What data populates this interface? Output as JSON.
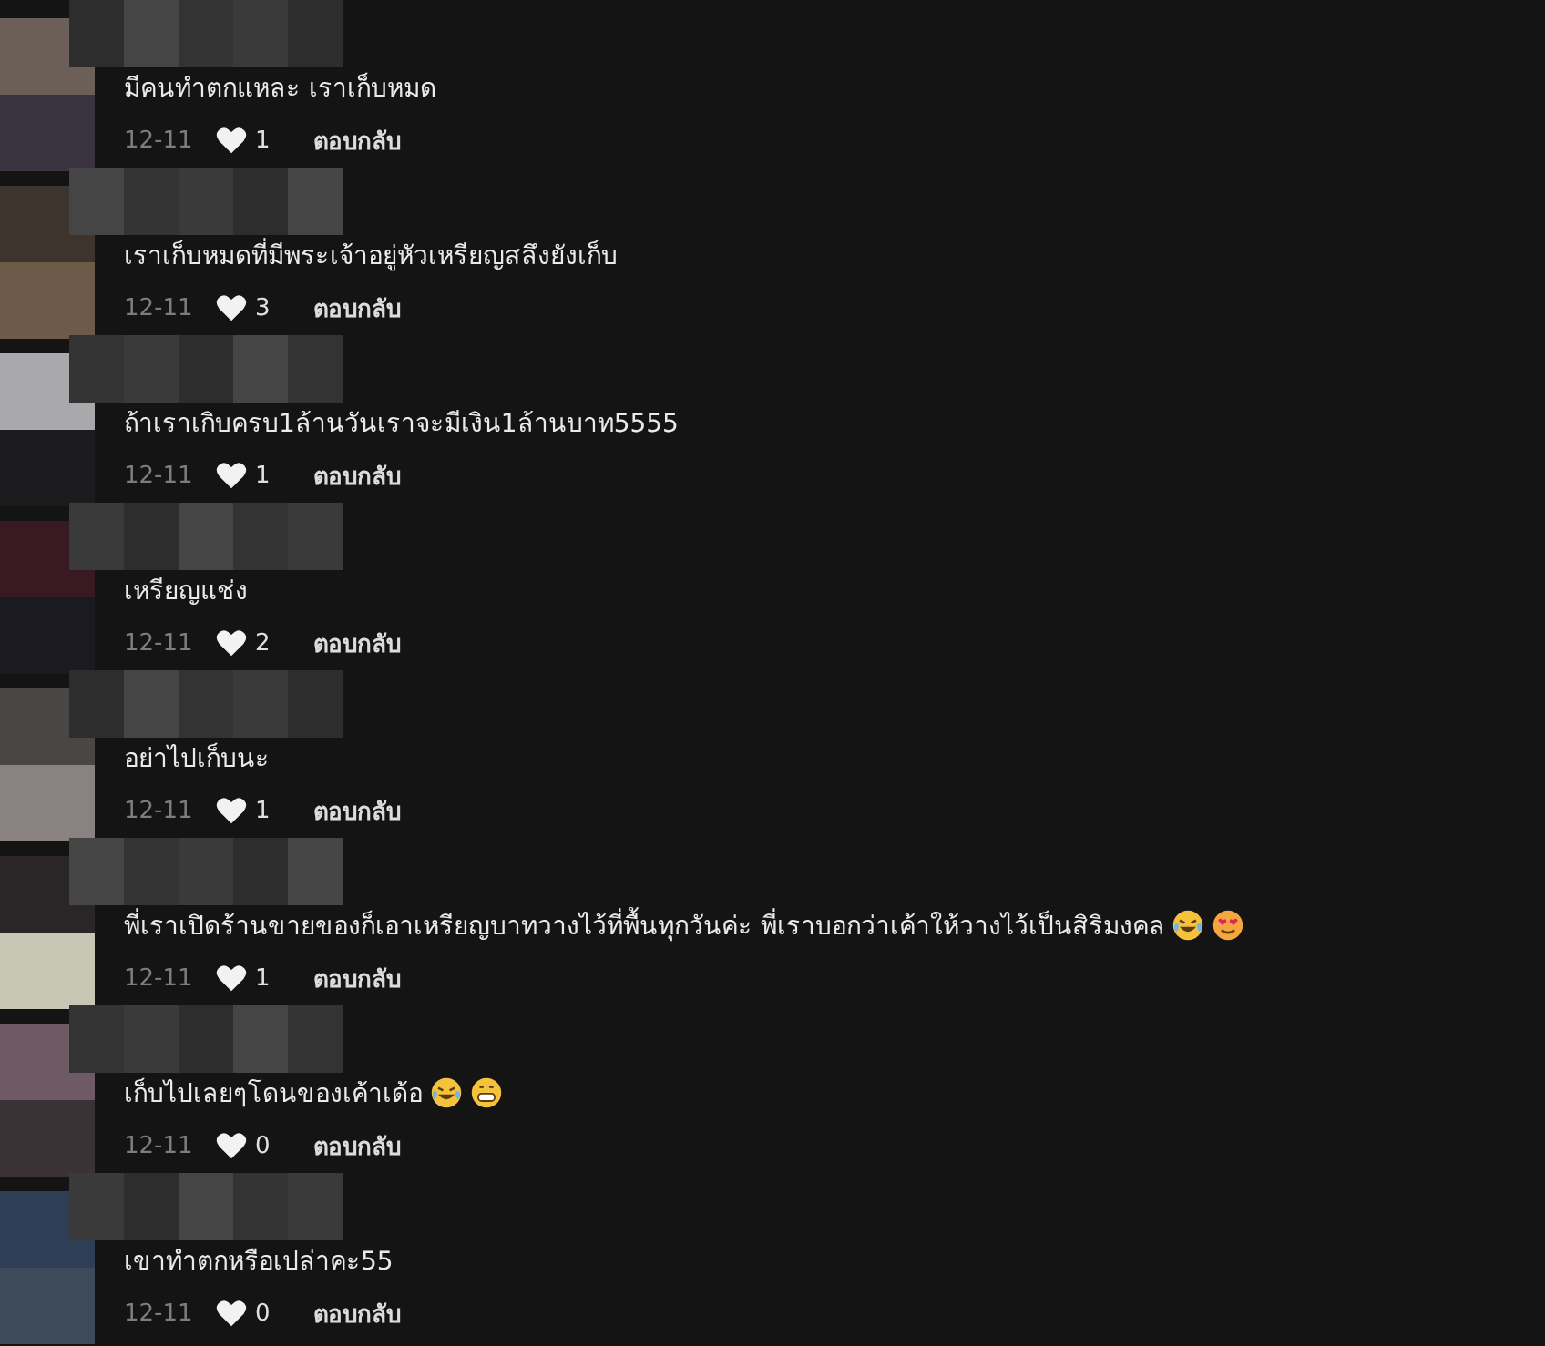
{
  "comments": [
    {
      "text": "มีคนทำตกแหละ เราเก็บหมด",
      "date": "12-11",
      "likes": "1",
      "reply": "ตอบกลับ"
    },
    {
      "text": "เราเก็บหมดที่มีพระเจ้าอยู่หัวเหรียญสลึงยังเก็บ",
      "date": "12-11",
      "likes": "3",
      "reply": "ตอบกลับ"
    },
    {
      "text": "ถ้าเราเกิบครบ1ล้านวันเราจะมีเงิน1ล้านบาท5555",
      "date": "12-11",
      "likes": "1",
      "reply": "ตอบกลับ"
    },
    {
      "text": "เหรียญแช่ง",
      "date": "12-11",
      "likes": "2",
      "reply": "ตอบกลับ"
    },
    {
      "text": "อย่าไปเก็บนะ",
      "date": "12-11",
      "likes": "1",
      "reply": "ตอบกลับ"
    },
    {
      "text": "พี่เราเปิดร้านขายของก็เอาเหรียญบาทวางไว้ที่พื้นทุกวันค่ะ พี่เราบอกว่าเค้าให้วางไว้เป็นสิริมงคล",
      "date": "12-11",
      "likes": "1",
      "reply": "ตอบกลับ",
      "emojis": [
        {
          "kind": "laughing"
        },
        {
          "kind": "hearts"
        }
      ]
    },
    {
      "text": "เก็บไปเลยๆโดนของเค้าเด้อ",
      "date": "12-11",
      "likes": "0",
      "reply": "ตอบกลับ",
      "emojis": [
        {
          "kind": "laughing"
        },
        {
          "kind": "grinning"
        }
      ]
    },
    {
      "text": "เขาทำตกหรือเปล่าคะ55",
      "date": "12-11",
      "likes": "0",
      "reply": "ตอบกลับ"
    }
  ]
}
